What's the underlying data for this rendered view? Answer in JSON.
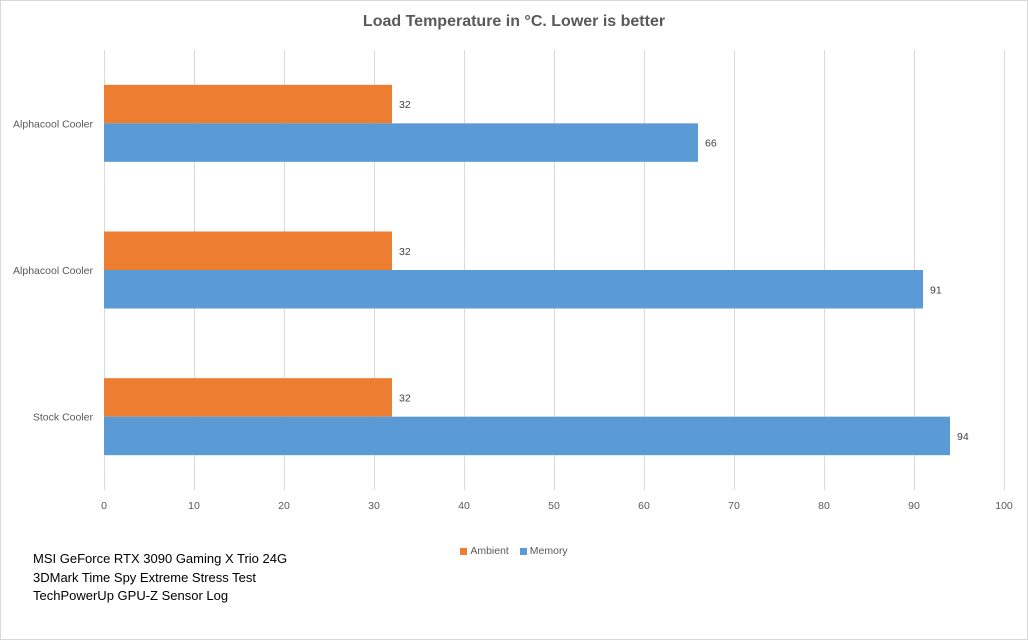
{
  "chart_data": {
    "type": "bar",
    "orientation": "horizontal",
    "title": "Load Temperature in °C. Lower is better",
    "categories": [
      "Alphacool Cooler",
      "Alphacool Cooler",
      "Stock Cooler"
    ],
    "series": [
      {
        "name": "Ambient",
        "color": "#ed7d31",
        "values": [
          32,
          32,
          32
        ]
      },
      {
        "name": "Memory",
        "color": "#5b9bd5",
        "values": [
          66,
          91,
          94
        ]
      }
    ],
    "xlabel": "",
    "ylabel": "",
    "xlim": [
      0,
      100
    ],
    "xticks": [
      0,
      10,
      20,
      30,
      40,
      50,
      60,
      70,
      80,
      90,
      100
    ],
    "grid": true,
    "legend_position": "bottom",
    "data_labels": true
  },
  "notes": [
    "MSI GeForce RTX 3090  Gaming X Trio 24G",
    "3DMark Time Spy Extreme Stress Test",
    "TechPowerUp GPU-Z Sensor Log"
  ]
}
